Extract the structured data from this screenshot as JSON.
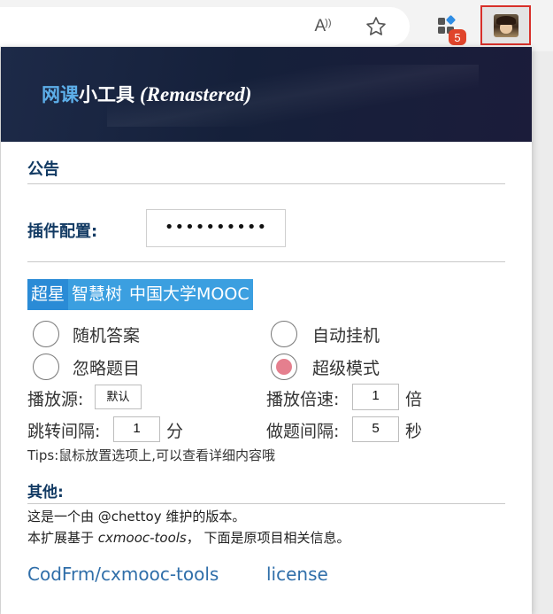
{
  "browser": {
    "read_aloud_label": "A",
    "extensions_badge": "5"
  },
  "popup": {
    "banner": {
      "title_highlight": "网课",
      "title_main": "小工具",
      "title_suffix": "(Remastered)"
    },
    "announcement_title": "公告",
    "config": {
      "label": "插件配置:",
      "value": "••••••••••"
    },
    "tabs": [
      {
        "label": "超星",
        "active": true
      },
      {
        "label": "智慧树",
        "active": false
      },
      {
        "label": "中国大学MOOC",
        "active": false
      }
    ],
    "options": {
      "random_answer": {
        "label": "随机答案",
        "checked": false
      },
      "auto_hang": {
        "label": "自动挂机",
        "checked": false
      },
      "ignore_questions": {
        "label": "忽略题目",
        "checked": false
      },
      "super_mode": {
        "label": "超级模式",
        "checked": true
      }
    },
    "fields": {
      "play_source_label": "播放源:",
      "play_source_value": "默认",
      "play_speed_label": "播放倍速:",
      "play_speed_value": "1",
      "play_speed_unit": "倍",
      "jump_interval_label": "跳转间隔:",
      "jump_interval_value": "1",
      "jump_interval_unit": "分",
      "answer_interval_label": "做题间隔:",
      "answer_interval_value": "5",
      "answer_interval_unit": "秒"
    },
    "tips": "Tips:鼠标放置选项上,可以查看详细内容哦",
    "other": {
      "title": "其他:",
      "line1": "这是一个由 @chettoy 维护的版本。",
      "line2_prefix": "本扩展基于 ",
      "line2_italic": "cxmooc-tools",
      "line2_suffix": "， 下面是原项目相关信息。"
    },
    "links": {
      "repo": "CodFrm/cxmooc-tools",
      "license": "license"
    }
  },
  "colors": {
    "accent_blue": "#3b9fe0",
    "title_blue": "#123a63",
    "radio_checked": "#e57f8e",
    "badge_red": "#e0442b",
    "link_blue": "#2f6ea9"
  }
}
